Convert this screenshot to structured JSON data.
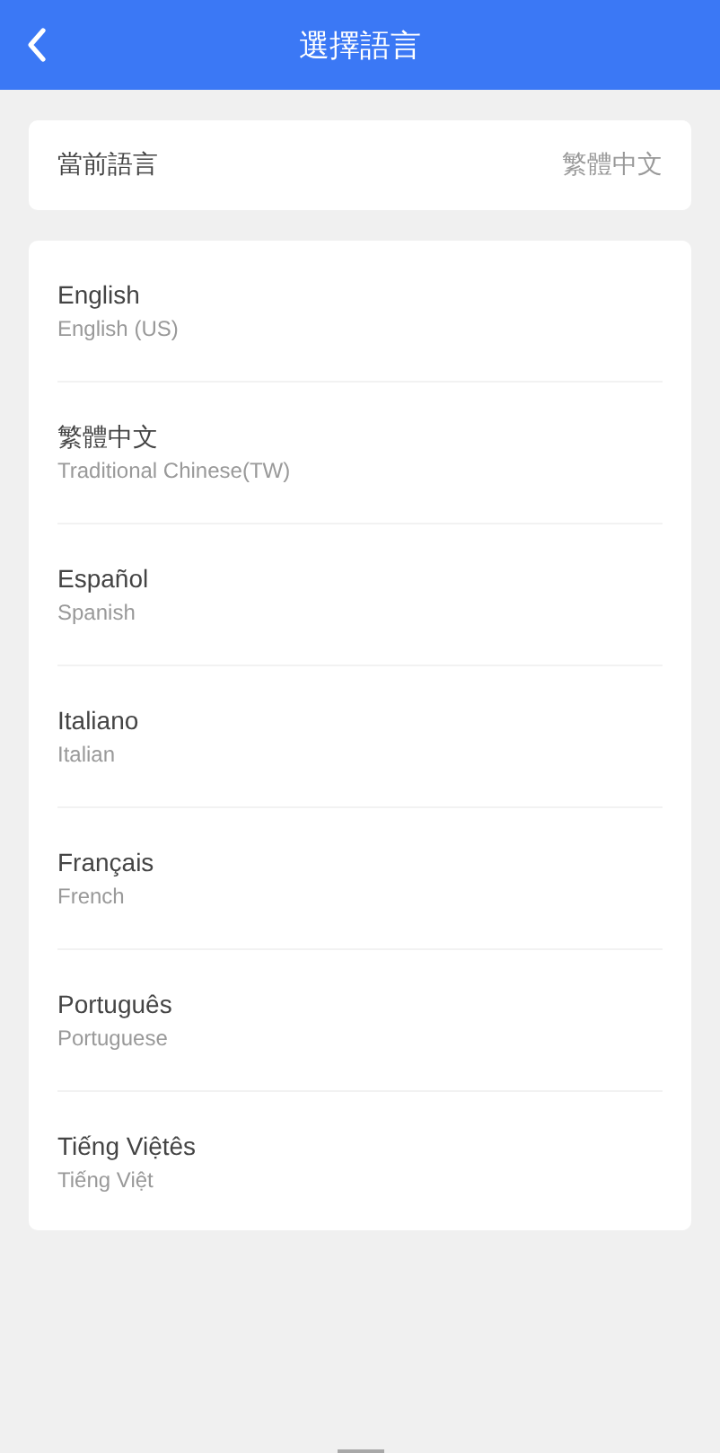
{
  "header": {
    "title": "選擇語言"
  },
  "current": {
    "label": "當前語言",
    "value": "繁體中文"
  },
  "languages": [
    {
      "name": "English",
      "subtitle": "English (US)"
    },
    {
      "name": "繁體中文",
      "subtitle": "Traditional Chinese(TW)"
    },
    {
      "name": "Español",
      "subtitle": "Spanish"
    },
    {
      "name": "Italiano",
      "subtitle": "Italian"
    },
    {
      "name": "Français",
      "subtitle": "French"
    },
    {
      "name": "Português",
      "subtitle": "Portuguese"
    },
    {
      "name": "Tiếng Việtês",
      "subtitle": "Tiếng Việt"
    }
  ]
}
